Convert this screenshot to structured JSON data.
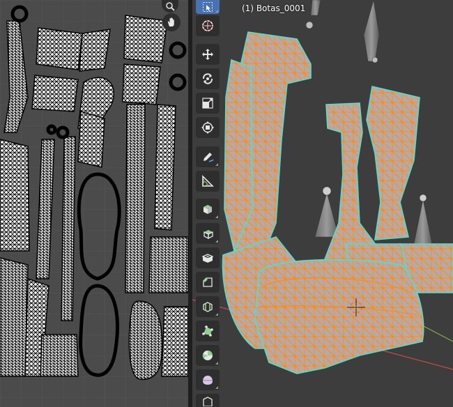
{
  "viewport": {
    "object_label": "(1) Botas_0001",
    "colors": {
      "background": "#3d3d3d",
      "mesh_fill": "#b7a9a3",
      "wire_selected": "#ff8a1a",
      "uv_seam": "#4fe0d0",
      "axis_x": "#c94a4a",
      "axis_y": "#7fae3a"
    }
  },
  "uv_editor": {
    "colors": {
      "background": "#4b4b4b",
      "grid": "#555555",
      "island_fill": "#ffffff",
      "island_wire": "#000000"
    },
    "nav_icons": [
      "zoom-icon",
      "hand-icon"
    ]
  },
  "toolbar": {
    "tools": [
      {
        "name": "select-box-tool",
        "icon": "cursor-arrow-icon",
        "active": true
      },
      {
        "name": "cursor-tool",
        "icon": "3d-cursor-icon",
        "active": false
      },
      {
        "name": "move-tool",
        "icon": "move-arrows-icon",
        "active": false
      },
      {
        "name": "rotate-tool",
        "icon": "rotate-icon",
        "active": false
      },
      {
        "name": "scale-tool",
        "icon": "scale-icon",
        "active": false
      },
      {
        "name": "transform-tool",
        "icon": "transform-icon",
        "active": false
      },
      {
        "name": "annotate-tool",
        "icon": "pencil-icon",
        "active": false
      },
      {
        "name": "measure-tool",
        "icon": "ruler-icon",
        "active": false
      },
      {
        "name": "add-cube-tool",
        "icon": "cube-add-icon",
        "active": false
      },
      {
        "name": "extrude-region-tool",
        "icon": "extrude-icon",
        "active": false
      },
      {
        "name": "inset-faces-tool",
        "icon": "inset-icon",
        "active": false
      },
      {
        "name": "bevel-tool",
        "icon": "bevel-icon",
        "active": false
      },
      {
        "name": "loop-cut-tool",
        "icon": "loop-cut-icon",
        "active": false
      },
      {
        "name": "poly-build-tool",
        "icon": "poly-build-icon",
        "active": false
      },
      {
        "name": "spin-tool",
        "icon": "spin-icon",
        "active": false
      },
      {
        "name": "smooth-tool",
        "icon": "smooth-icon",
        "active": false
      },
      {
        "name": "edge-slide-tool",
        "icon": "edge-slide-icon",
        "active": false
      }
    ]
  }
}
